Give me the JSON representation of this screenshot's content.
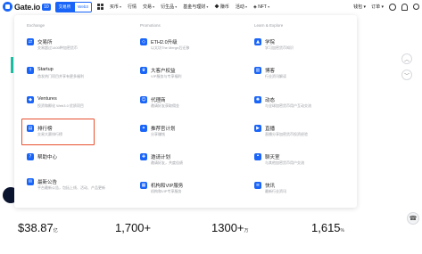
{
  "nav": {
    "logo_text": "Gate.io",
    "logo_badge": "10",
    "seg_on": "交易所",
    "seg_off": "Web3",
    "items": [
      "买币",
      "行情",
      "交易",
      "衍生品",
      "赚币",
      "活动",
      "NFT"
    ],
    "earn_label": "基金与理财",
    "right_items": [
      "钱包",
      "订单"
    ]
  },
  "panel": {
    "col1_head": "Exchange",
    "col2_head": "Promotions",
    "col3_head": "Learn & Explore",
    "col1": [
      {
        "title": "交易所",
        "sub": "交易超过1400种加密货币"
      },
      {
        "title": "Startup",
        "sub": "首发热门项目并享有更多福利"
      },
      {
        "title": "Ventures",
        "sub": "投资和孵化 Web3.0 优质项目"
      },
      {
        "title": "排行榜",
        "sub": "交易大赛排行榜"
      },
      {
        "title": "帮助中心",
        "sub": ""
      },
      {
        "title": "最新公告",
        "sub": "平台最新公告，包括上线、活动、产品更新"
      }
    ],
    "col2": [
      {
        "title": "ETH2.0升级",
        "sub": "以太坊The Merge后迁移"
      },
      {
        "title": "大客户权益",
        "sub": "VIP服务与专享福利"
      },
      {
        "title": "代理商",
        "sub": "邀请好友获取佣金"
      },
      {
        "title": "推荐官计划",
        "sub": "分享赚钱"
      },
      {
        "title": "邀请计划",
        "sub": "邀请好友，共度佳绩"
      },
      {
        "title": "机构和VIP服务",
        "sub": "机构和VIP专享服务"
      }
    ],
    "col3": [
      {
        "title": "学院",
        "sub": "学习加密货币知识"
      },
      {
        "title": "博客",
        "sub": "行业资讯解读"
      },
      {
        "title": "动态",
        "sub": "与全球加密货币用户互动交流"
      },
      {
        "title": "直播",
        "sub": "直播分享加密货币投资经验"
      },
      {
        "title": "聊天室",
        "sub": "与其他加密货币用户交流"
      },
      {
        "title": "快讯",
        "sub": "最新行业资讯"
      }
    ]
  },
  "stats": [
    {
      "value": "$38.87",
      "unit": "亿"
    },
    {
      "value": "1,700+",
      "unit": ""
    },
    {
      "value": "1300+",
      "unit": "万"
    },
    {
      "value": "1,615",
      "unit": "%"
    }
  ],
  "colors": {
    "accent": "#1a65f8",
    "highlight": "#e8502f",
    "green": "#19c4a6"
  }
}
